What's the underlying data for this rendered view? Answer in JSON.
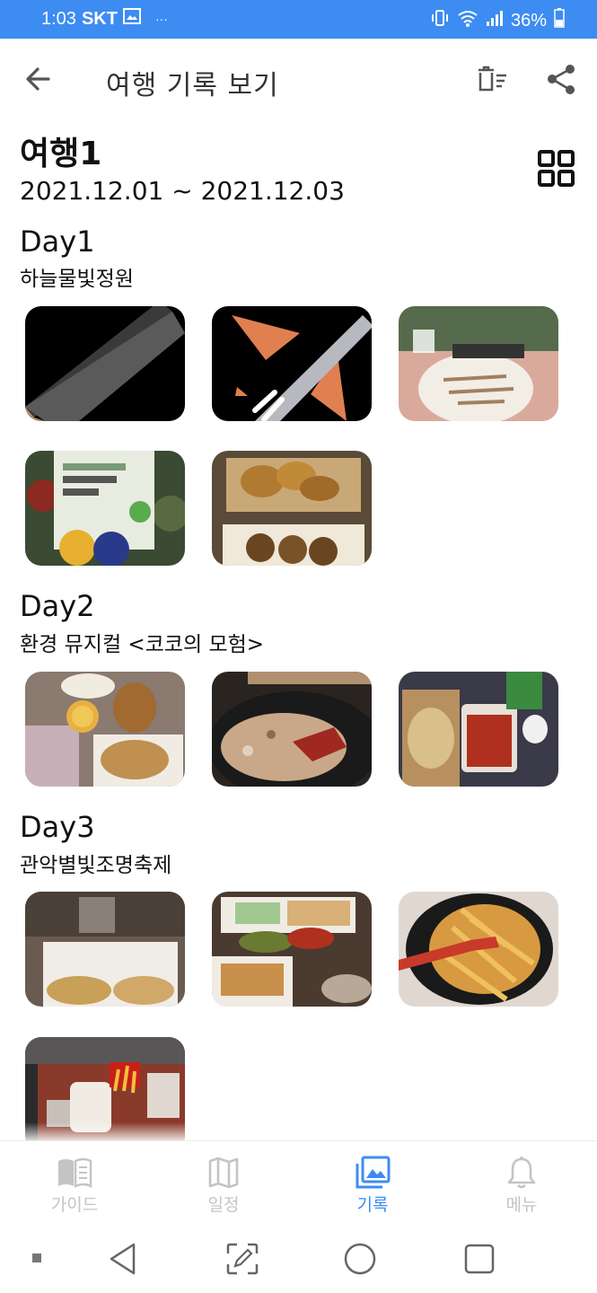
{
  "status_bar": {
    "time": "1:03",
    "carrier": "SKT",
    "more": "···",
    "battery": "36%"
  },
  "app_bar": {
    "title": "여행 기록 보기",
    "back_icon": "arrow-left-icon",
    "delete_icon": "delete-list-icon",
    "share_icon": "share-icon"
  },
  "trip": {
    "title": "여행1",
    "dates": "2021.12.01 ~ 2021.12.03",
    "view_toggle_icon": "grid-icon"
  },
  "days": [
    {
      "label": "Day1",
      "place": "하늘물빛정원",
      "photos": [
        "pencil-photo",
        "pen-photo",
        "chicken-breast-package-photo",
        "salad-package-photo",
        "fried-chicken-box-photo"
      ]
    },
    {
      "label": "Day2",
      "place": "환경 뮤지컬 <코코의 모험>",
      "photos": [
        "snack-table-photo",
        "fried-rice-pan-photo",
        "chicken-takeout-photo"
      ]
    },
    {
      "label": "Day3",
      "place": "관악별빛조명축제",
      "photos": [
        "chicken-table-photo",
        "pork-cutlet-table-photo",
        "tteokbokki-pan-photo",
        "fast-food-tray-photo"
      ]
    }
  ],
  "bottom_nav": [
    {
      "label": "가이드",
      "icon": "book-icon",
      "active": false
    },
    {
      "label": "일정",
      "icon": "map-icon",
      "active": false
    },
    {
      "label": "기록",
      "icon": "gallery-icon",
      "active": true
    },
    {
      "label": "메뉴",
      "icon": "bell-icon",
      "active": false
    }
  ],
  "colors": {
    "accent": "#3d8cf2",
    "inactive": "#c4c4c4",
    "text": "#111111"
  }
}
